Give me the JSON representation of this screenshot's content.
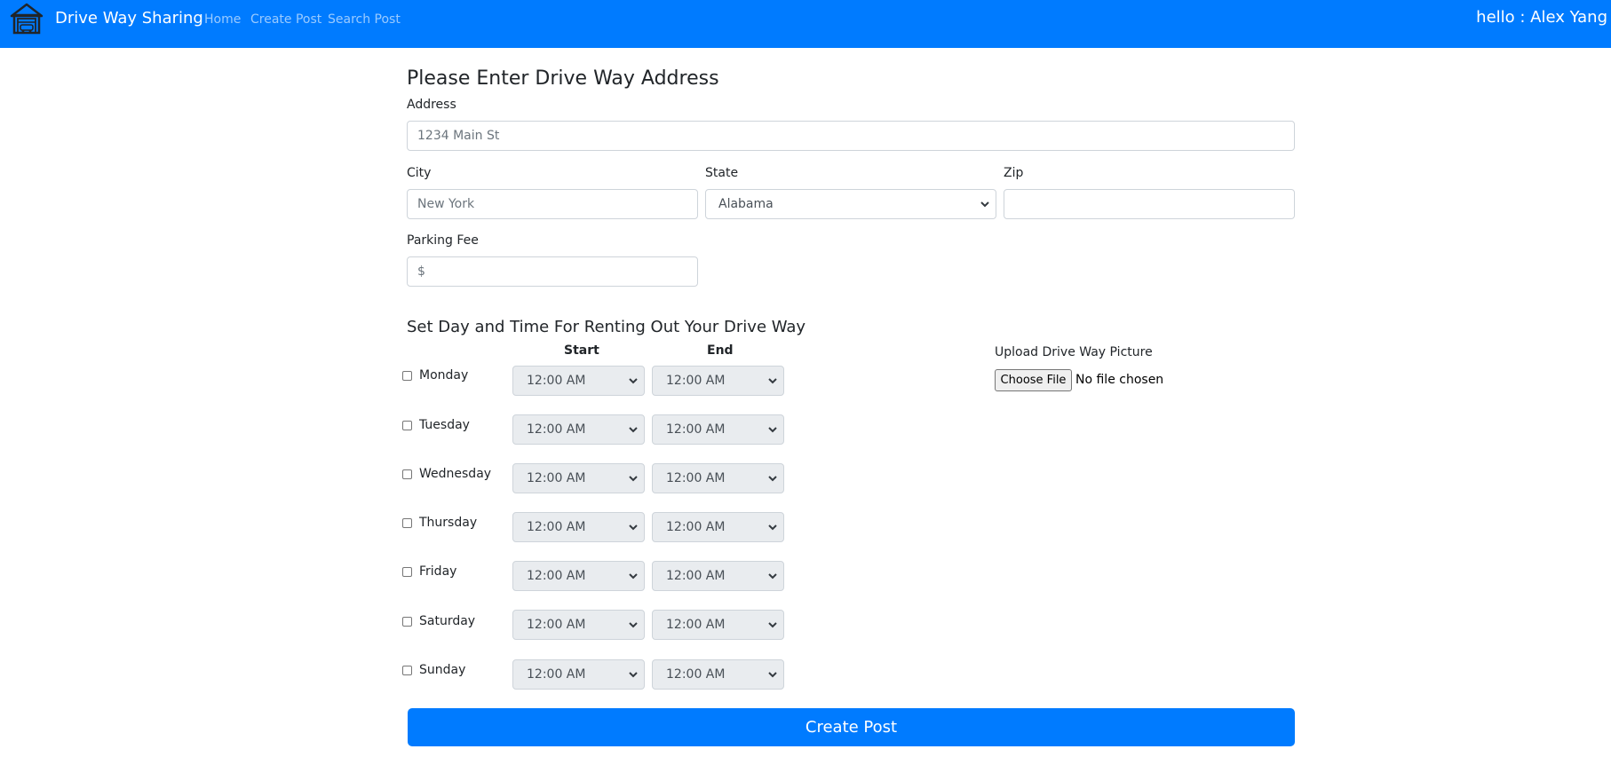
{
  "navbar": {
    "brand": "Drive Way Sharing",
    "links": [
      "Home",
      "Create Post",
      "Search Post"
    ],
    "greeting": "hello : Alex Yang",
    "brand_icon": "garage-icon",
    "background_color": "#007bff"
  },
  "address_section": {
    "heading": "Please Enter Drive Way Address",
    "address": {
      "label": "Address",
      "placeholder": "1234 Main St",
      "value": ""
    },
    "city": {
      "label": "City",
      "placeholder": "New York",
      "value": ""
    },
    "state": {
      "label": "State",
      "selected": "Alabama"
    },
    "zip": {
      "label": "Zip",
      "placeholder": "",
      "value": ""
    },
    "fee": {
      "label": "Parking Fee",
      "placeholder": "$",
      "value": ""
    }
  },
  "schedule": {
    "heading": "Set Day and Time For Renting Out Your Drive Way",
    "start_header": "Start",
    "end_header": "End",
    "days": [
      {
        "name": "Monday",
        "checked": false,
        "start": "12:00 AM",
        "end": "12:00 AM"
      },
      {
        "name": "Tuesday",
        "checked": false,
        "start": "12:00 AM",
        "end": "12:00 AM"
      },
      {
        "name": "Wednesday",
        "checked": false,
        "start": "12:00 AM",
        "end": "12:00 AM"
      },
      {
        "name": "Thursday",
        "checked": false,
        "start": "12:00 AM",
        "end": "12:00 AM"
      },
      {
        "name": "Friday",
        "checked": false,
        "start": "12:00 AM",
        "end": "12:00 AM"
      },
      {
        "name": "Saturday",
        "checked": false,
        "start": "12:00 AM",
        "end": "12:00 AM"
      },
      {
        "name": "Sunday",
        "checked": false,
        "start": "12:00 AM",
        "end": "12:00 AM"
      }
    ]
  },
  "upload": {
    "label": "Upload Drive Way Picture",
    "button": "Choose File",
    "status": "No file chosen"
  },
  "submit_label": "Create Post"
}
